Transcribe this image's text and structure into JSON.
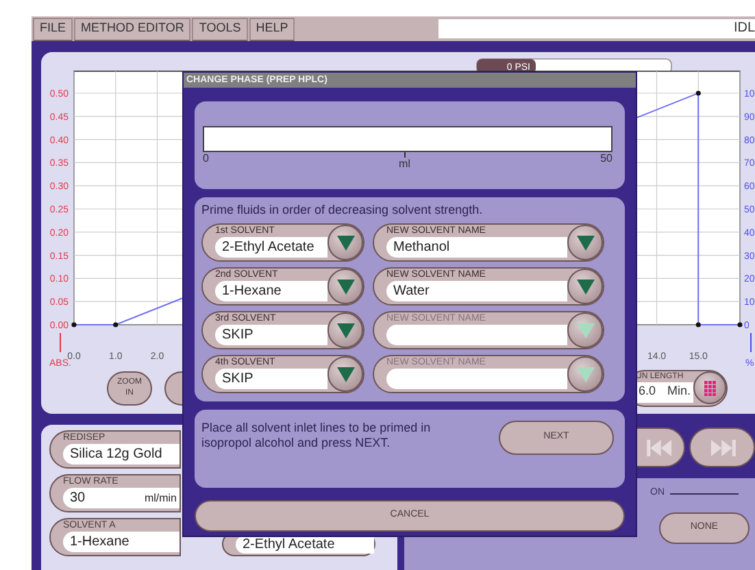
{
  "menu": [
    {
      "label": "FILE"
    },
    {
      "label": "METHOD EDITOR"
    },
    {
      "label": "TOOLS"
    },
    {
      "label": "HELP"
    }
  ],
  "status": {
    "text": "IDL"
  },
  "chart_panel": {
    "pressure": "0 PSI",
    "chart_data": {
      "type": "line",
      "ylabel": "ABS.",
      "xlim": [
        0,
        16
      ],
      "ylim": [
        0,
        0.5
      ],
      "x": [
        0,
        1,
        15,
        15,
        16
      ],
      "grid": true,
      "series": [
        {
          "color": "#6f6ff5",
          "marker": true,
          "values": [
            0,
            0,
            0.5,
            0,
            0
          ]
        }
      ],
      "xticks": [
        {
          "value": 0,
          "label": "0.0"
        },
        {
          "value": 1,
          "label": "1.0"
        },
        {
          "value": 2,
          "label": "2.0"
        },
        {
          "value": 14,
          "label": "14.0"
        },
        {
          "value": 15,
          "label": "15.0"
        }
      ],
      "yticks": [
        {
          "value": 0.5,
          "label": "0.50"
        },
        {
          "value": 0.45,
          "label": "0.45"
        },
        {
          "value": 0.4,
          "label": "0.40"
        },
        {
          "value": 0.35,
          "label": "0.35"
        },
        {
          "value": 0.3,
          "label": "0.30"
        },
        {
          "value": 0.25,
          "label": "0.25"
        },
        {
          "value": 0.2,
          "label": "0.20"
        },
        {
          "value": 0.15,
          "label": "0.15"
        },
        {
          "value": 0.1,
          "label": "0.10"
        },
        {
          "value": 0.05,
          "label": "0.05"
        },
        {
          "value": 0,
          "label": "0.00"
        }
      ]
    },
    "right_axis": {
      "label": "%",
      "ticks": [
        "10",
        "90",
        "80",
        "70",
        "60",
        "50",
        "40",
        "30",
        "20",
        "10",
        "0"
      ]
    },
    "zoom_button": "ZOOM IN",
    "run_length": {
      "label": "UN LENGTH",
      "value": "6.0",
      "unit": "Min."
    }
  },
  "method_panel": {
    "fields": [
      {
        "label": "REDISEP",
        "value": "Silica 12g Gold"
      },
      {
        "label": "FLOW RATE",
        "value": "30",
        "unit": "ml/min"
      },
      {
        "label": "SOLVENT A",
        "value": "1-Hexane"
      }
    ],
    "solvent_b": "2-Ethyl Acetate"
  },
  "transport": [
    {
      "kind": "skip_back",
      "disabled": true
    },
    {
      "kind": "skip_forward",
      "disabled": true
    }
  ],
  "lower_right": {
    "section_label": "ON",
    "button": "NONE"
  },
  "dialog": {
    "title": "CHANGE PHASE (PREP HPLC)",
    "progress": {
      "level": 0,
      "min": "0",
      "max": "50",
      "unit": "ml"
    },
    "prompt": "Prime fluids in order of decreasing solvent strength.",
    "solvents": [
      {
        "label": "1st SOLVENT",
        "value": "2-Ethyl Acetate",
        "new_label": "NEW SOLVENT NAME",
        "new_value": "Methanol",
        "new_disabled": false
      },
      {
        "label": "2nd SOLVENT",
        "value": "1-Hexane",
        "new_label": "NEW SOLVENT NAME",
        "new_value": "Water",
        "new_disabled": false
      },
      {
        "label": "3rd SOLVENT",
        "value": "SKIP",
        "new_label": "NEW SOLVENT NAME",
        "new_disabled": true
      },
      {
        "label": "4th SOLVENT",
        "value": "SKIP",
        "new_label": "NEW SOLVENT NAME",
        "new_disabled": true
      }
    ],
    "instruction": "Place all solvent inlet lines to be primed in isopropol alcohol and press NEXT.",
    "next_button": "NEXT",
    "cancel_button": "CANCEL"
  }
}
